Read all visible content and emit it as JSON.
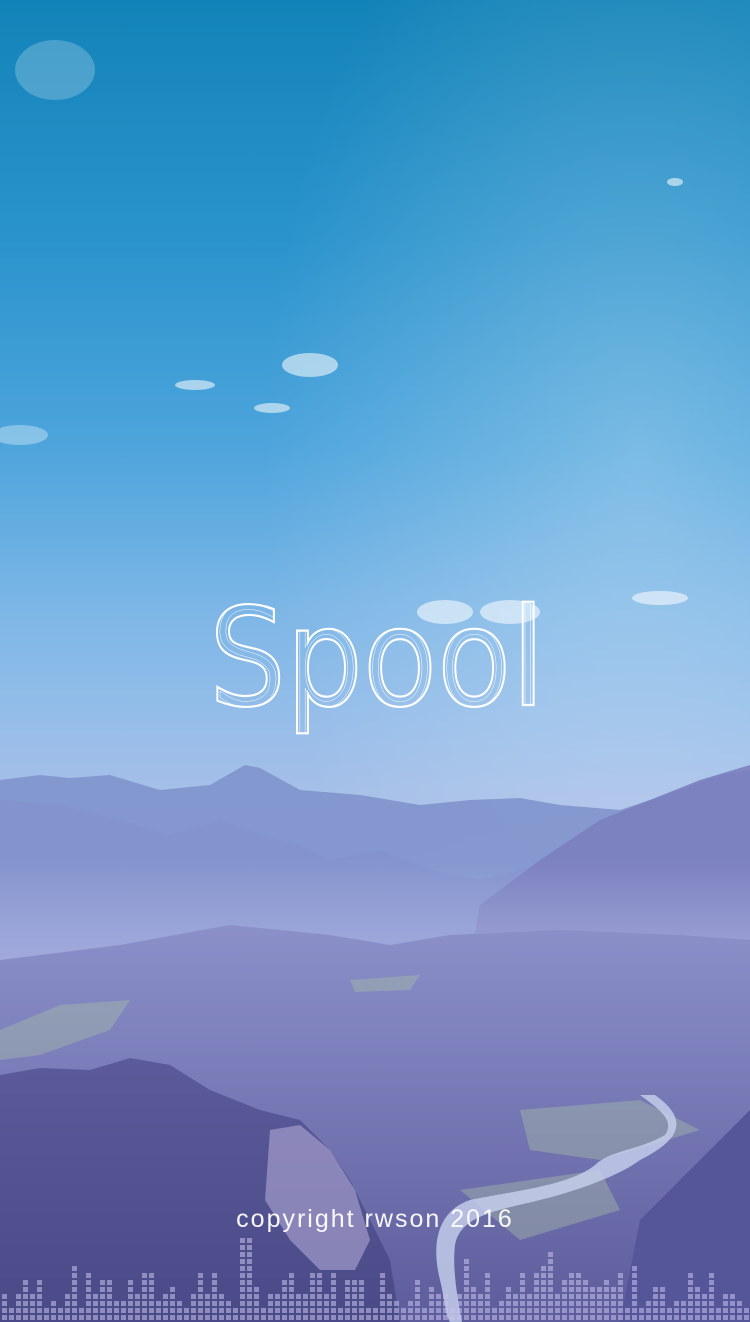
{
  "splash": {
    "app_name": "Spool",
    "copyright": "copyright rwson 2016"
  },
  "theme": {
    "title_color": "#ffffff",
    "equalizer_color": "#c9c3ee"
  },
  "icons": {
    "equalizer": "audio-equalizer-bars"
  }
}
